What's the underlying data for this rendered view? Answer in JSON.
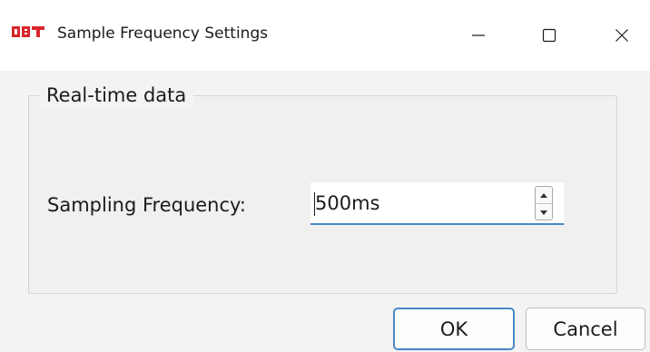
{
  "window": {
    "title": "Sample Frequency Settings",
    "icon": "app-logo-icon",
    "accent_color": "#4a86c8",
    "controls": {
      "minimize": "minimize-icon",
      "maximize": "maximize-icon",
      "close": "close-icon"
    }
  },
  "group": {
    "title": "Real-time data",
    "field_label": "Sampling Frequency:",
    "field_value": "500ms"
  },
  "buttons": {
    "ok_label": "OK",
    "cancel_label": "Cancel"
  }
}
